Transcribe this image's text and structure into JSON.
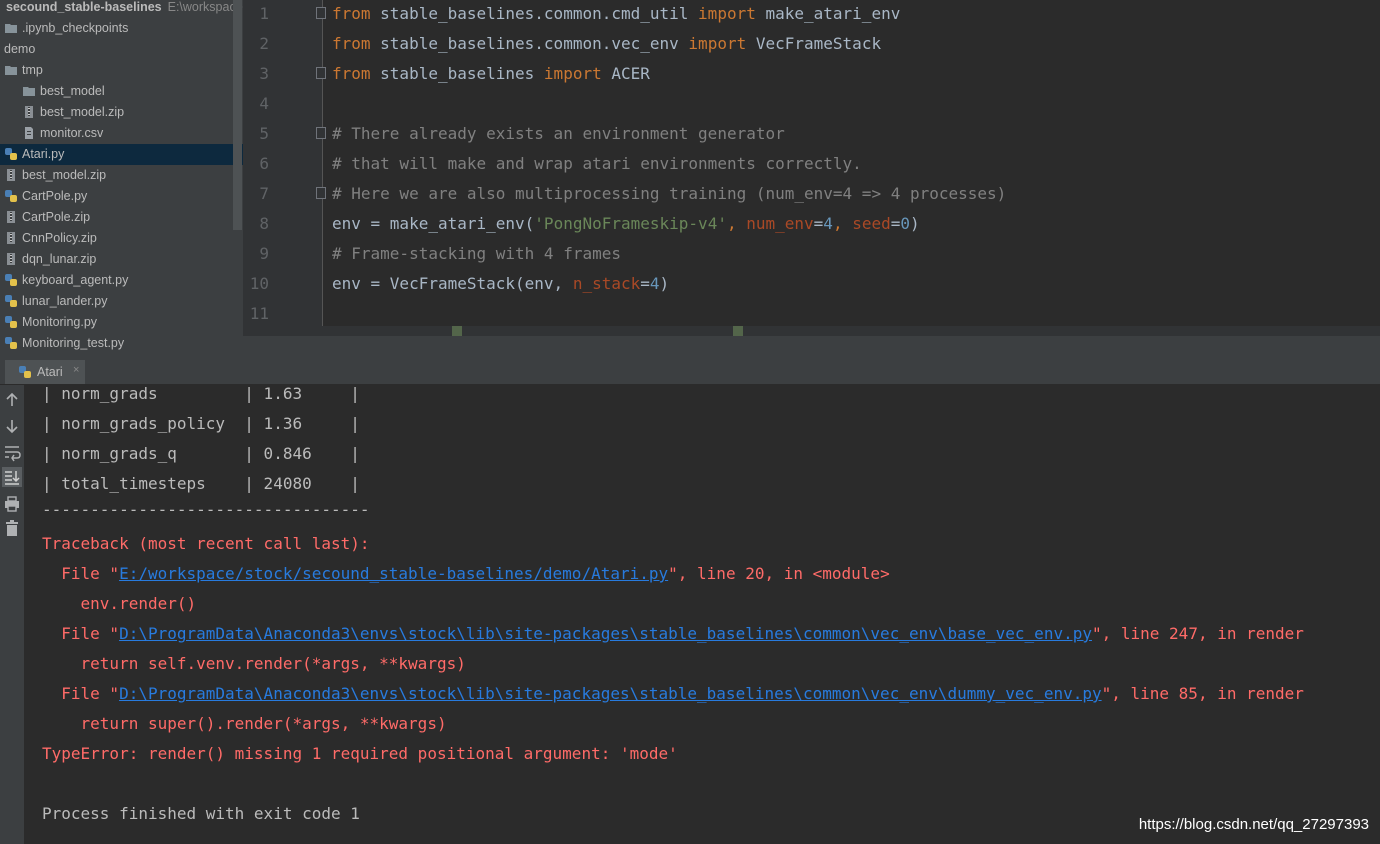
{
  "project": {
    "root_name": "secound_stable-baselines",
    "root_path": "E:\\workspace"
  },
  "tree": [
    {
      "label": ".ipynb_checkpoints",
      "type": "folder"
    },
    {
      "label": "demo",
      "type": "folder"
    },
    {
      "label": "tmp",
      "type": "folder-open"
    },
    {
      "label": "best_model",
      "type": "folder"
    },
    {
      "label": "best_model.zip",
      "type": "zip"
    },
    {
      "label": "monitor.csv",
      "type": "file"
    },
    {
      "label": "Atari.py",
      "type": "python",
      "selected": true
    },
    {
      "label": "best_model.zip",
      "type": "zip"
    },
    {
      "label": "CartPole.py",
      "type": "python"
    },
    {
      "label": "CartPole.zip",
      "type": "zip"
    },
    {
      "label": "CnnPolicy.zip",
      "type": "zip"
    },
    {
      "label": "dqn_lunar.zip",
      "type": "zip"
    },
    {
      "label": "keyboard_agent.py",
      "type": "python"
    },
    {
      "label": "lunar_lander.py",
      "type": "python"
    },
    {
      "label": "Monitoring.py",
      "type": "python"
    },
    {
      "label": "Monitoring_test.py",
      "type": "python"
    }
  ],
  "editor": {
    "line_numbers": [
      "1",
      "2",
      "3",
      "4",
      "5",
      "6",
      "7",
      "8",
      "9",
      "10",
      "11"
    ],
    "l1": {
      "kw1": "from",
      "mod": " stable_baselines.common.cmd_util ",
      "kw2": "import",
      "name": " make_atari_env"
    },
    "l2": {
      "kw1": "from",
      "mod": " stable_baselines.common.vec_env ",
      "kw2": "import",
      "name": " VecFrameStack"
    },
    "l3": {
      "kw1": "from",
      "mod": " stable_baselines ",
      "kw2": "import",
      "name": " ACER"
    },
    "l5": "# There already exists an environment generator",
    "l6": "# that will make and wrap atari environments correctly.",
    "l7": "# Here we are also multiprocessing training (num_env=4 => 4 processes)",
    "l8": {
      "a": "env = make_atari_env(",
      "str": "'PongNoFrameskip-v4'",
      "sep1": ", ",
      "p1": "num_env",
      "eq1": "=",
      "n1": "4",
      "sep2": ", ",
      "p2": "seed",
      "eq2": "=",
      "n2": "0",
      "end": ")"
    },
    "l9": "# Frame-stacking with 4 frames",
    "l10": {
      "a": "env = VecFrameStack(env, ",
      "p": "n_stack",
      "eq": "=",
      "n": "4",
      "end": ")"
    }
  },
  "run_tab": {
    "label": "Atari",
    "close": "×"
  },
  "console": {
    "table": [
      "| norm_grads         | 1.63     |",
      "| norm_grads_policy  | 1.36     |",
      "| norm_grads_q       | 0.846    |",
      "| total_timesteps    | 24080    |",
      "----------------------------------"
    ],
    "traceback_header": "Traceback (most recent call last):",
    "frames": [
      {
        "pre": "  File \"",
        "path": "E:/workspace/stock/secound_stable-baselines/demo/Atari.py",
        "post": "\", line 20, in <module>",
        "code": "    env.render()"
      },
      {
        "pre": "  File \"",
        "path": "D:\\ProgramData\\Anaconda3\\envs\\stock\\lib\\site-packages\\stable_baselines\\common\\vec_env\\base_vec_env.py",
        "post": "\", line 247, in render",
        "code": "    return self.venv.render(*args, **kwargs)"
      },
      {
        "pre": "  File \"",
        "path": "D:\\ProgramData\\Anaconda3\\envs\\stock\\lib\\site-packages\\stable_baselines\\common\\vec_env\\dummy_vec_env.py",
        "post": "\", line 85, in render",
        "code": "    return super().render(*args, **kwargs)"
      }
    ],
    "error": "TypeError: render() missing 1 required positional argument: 'mode'",
    "exit": "Process finished with exit code 1"
  },
  "watermark": "https://blog.csdn.net/qq_27297393",
  "toolbar_icons": [
    "arrow-up-icon",
    "arrow-down-icon",
    "soft-wrap-icon",
    "scroll-to-end-icon",
    "print-icon",
    "trash-icon"
  ],
  "colors": {
    "keyword": "#cc7832",
    "comment": "#808080",
    "string": "#6a8759",
    "number": "#6897bb",
    "error": "#ff6b68",
    "link": "#287bde",
    "selection": "#0d293e"
  }
}
